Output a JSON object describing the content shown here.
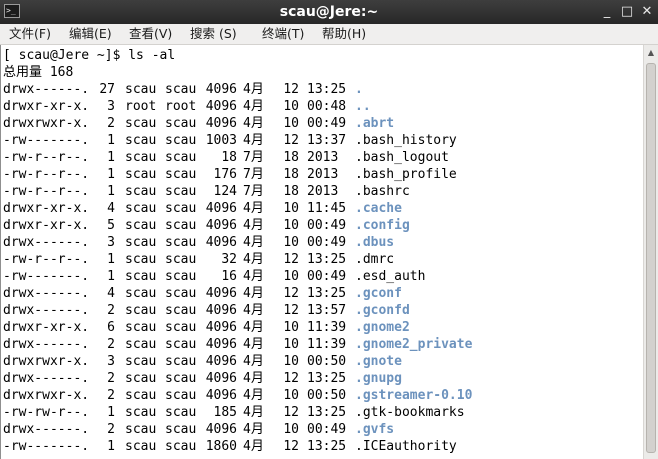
{
  "window": {
    "title": "scau@Jere:~",
    "icon": "terminal-icon",
    "minimize_glyph": "_",
    "maximize_glyph": "□",
    "close_glyph": "✕"
  },
  "menu": [
    "文件(F)",
    "编辑(E)",
    "查看(V)",
    "搜索 (S)",
    "终端(T)",
    "帮助(H)"
  ],
  "terminal": {
    "prompt": "[ scau@Jere ~]$ ls -al",
    "total": "总用量 168",
    "entries": [
      {
        "perms": "drwx------.",
        "links": "27",
        "owner": "scau",
        "group": "scau",
        "size": "4096",
        "month": "4月",
        "day": "12",
        "time": "13:25",
        "name": ".",
        "dir": true
      },
      {
        "perms": "drwxr-xr-x.",
        "links": "3",
        "owner": "root",
        "group": "root",
        "size": "4096",
        "month": "4月",
        "day": "10",
        "time": "00:48",
        "name": "..",
        "dir": true
      },
      {
        "perms": "drwxrwxr-x.",
        "links": "2",
        "owner": "scau",
        "group": "scau",
        "size": "4096",
        "month": "4月",
        "day": "10",
        "time": "00:49",
        "name": ".abrt",
        "dir": true
      },
      {
        "perms": "-rw-------.",
        "links": "1",
        "owner": "scau",
        "group": "scau",
        "size": "1003",
        "month": "4月",
        "day": "12",
        "time": "13:37",
        "name": ".bash_history",
        "dir": false
      },
      {
        "perms": "-rw-r--r--.",
        "links": "1",
        "owner": "scau",
        "group": "scau",
        "size": "18",
        "month": "7月",
        "day": "18",
        "time": "2013",
        "name": ".bash_logout",
        "dir": false
      },
      {
        "perms": "-rw-r--r--.",
        "links": "1",
        "owner": "scau",
        "group": "scau",
        "size": "176",
        "month": "7月",
        "day": "18",
        "time": "2013",
        "name": ".bash_profile",
        "dir": false
      },
      {
        "perms": "-rw-r--r--.",
        "links": "1",
        "owner": "scau",
        "group": "scau",
        "size": "124",
        "month": "7月",
        "day": "18",
        "time": "2013",
        "name": ".bashrc",
        "dir": false
      },
      {
        "perms": "drwxr-xr-x.",
        "links": "4",
        "owner": "scau",
        "group": "scau",
        "size": "4096",
        "month": "4月",
        "day": "10",
        "time": "11:45",
        "name": ".cache",
        "dir": true
      },
      {
        "perms": "drwxr-xr-x.",
        "links": "5",
        "owner": "scau",
        "group": "scau",
        "size": "4096",
        "month": "4月",
        "day": "10",
        "time": "00:49",
        "name": ".config",
        "dir": true
      },
      {
        "perms": "drwx------.",
        "links": "3",
        "owner": "scau",
        "group": "scau",
        "size": "4096",
        "month": "4月",
        "day": "10",
        "time": "00:49",
        "name": ".dbus",
        "dir": true
      },
      {
        "perms": "-rw-r--r--.",
        "links": "1",
        "owner": "scau",
        "group": "scau",
        "size": "32",
        "month": "4月",
        "day": "12",
        "time": "13:25",
        "name": ".dmrc",
        "dir": false
      },
      {
        "perms": "-rw-------.",
        "links": "1",
        "owner": "scau",
        "group": "scau",
        "size": "16",
        "month": "4月",
        "day": "10",
        "time": "00:49",
        "name": ".esd_auth",
        "dir": false
      },
      {
        "perms": "drwx------.",
        "links": "4",
        "owner": "scau",
        "group": "scau",
        "size": "4096",
        "month": "4月",
        "day": "12",
        "time": "13:25",
        "name": ".gconf",
        "dir": true
      },
      {
        "perms": "drwx------.",
        "links": "2",
        "owner": "scau",
        "group": "scau",
        "size": "4096",
        "month": "4月",
        "day": "12",
        "time": "13:57",
        "name": ".gconfd",
        "dir": true
      },
      {
        "perms": "drwxr-xr-x.",
        "links": "6",
        "owner": "scau",
        "group": "scau",
        "size": "4096",
        "month": "4月",
        "day": "10",
        "time": "11:39",
        "name": ".gnome2",
        "dir": true
      },
      {
        "perms": "drwx------.",
        "links": "2",
        "owner": "scau",
        "group": "scau",
        "size": "4096",
        "month": "4月",
        "day": "10",
        "time": "11:39",
        "name": ".gnome2_private",
        "dir": true
      },
      {
        "perms": "drwxrwxr-x.",
        "links": "3",
        "owner": "scau",
        "group": "scau",
        "size": "4096",
        "month": "4月",
        "day": "10",
        "time": "00:50",
        "name": ".gnote",
        "dir": true
      },
      {
        "perms": "drwx------.",
        "links": "2",
        "owner": "scau",
        "group": "scau",
        "size": "4096",
        "month": "4月",
        "day": "12",
        "time": "13:25",
        "name": ".gnupg",
        "dir": true
      },
      {
        "perms": "drwxrwxr-x.",
        "links": "2",
        "owner": "scau",
        "group": "scau",
        "size": "4096",
        "month": "4月",
        "day": "10",
        "time": "00:50",
        "name": ".gstreamer-0.10",
        "dir": true
      },
      {
        "perms": "-rw-rw-r--.",
        "links": "1",
        "owner": "scau",
        "group": "scau",
        "size": "185",
        "month": "4月",
        "day": "12",
        "time": "13:25",
        "name": ".gtk-bookmarks",
        "dir": false
      },
      {
        "perms": "drwx------.",
        "links": "2",
        "owner": "scau",
        "group": "scau",
        "size": "4096",
        "month": "4月",
        "day": "10",
        "time": "00:49",
        "name": ".gvfs",
        "dir": true
      },
      {
        "perms": "-rw-------.",
        "links": "1",
        "owner": "scau",
        "group": "scau",
        "size": "1860",
        "month": "4月",
        "day": "12",
        "time": "13:25",
        "name": ".ICEauthority",
        "dir": false
      }
    ]
  }
}
